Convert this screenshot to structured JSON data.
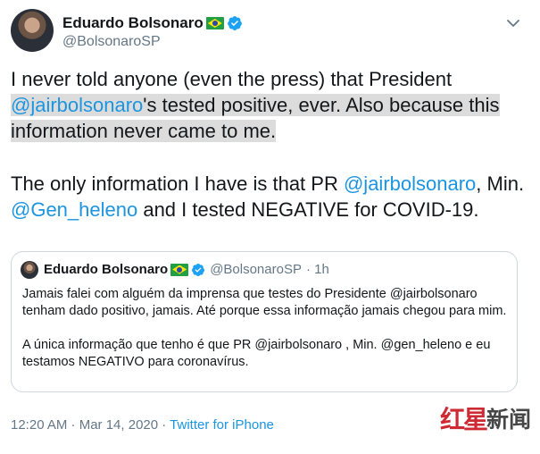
{
  "author": {
    "name": "Eduardo Bolsonaro",
    "handle": "@BolsonaroSP",
    "flag": "brazil-flag-emoji",
    "verified_color": "#1da1f2"
  },
  "tweet": {
    "line1_pre": "I never told anyone (even the press) that President",
    "mention1": "@jairbolsonaro",
    "line2_hl": "'s tested positive, ever. Also because this information never came to me.",
    "p2_pre": "The only information I have is that PR ",
    "mention2": "@jairbolsonaro",
    "p2_mid1": ", Min. ",
    "mention3": "@Gen_heleno",
    "p2_end": " and I tested NEGATIVE for COVID-19."
  },
  "quote": {
    "name": "Eduardo Bolsonaro",
    "handle": "@BolsonaroSP",
    "time": "· 1h",
    "para1": "Jamais falei com alguém da imprensa que testes do Presidente @jairbolsonaro tenham dado positivo, jamais. Até porque essa informação jamais chegou para mim.",
    "para2": "A única informação que tenho é que PR @jairbolsonaro , Min. @gen_heleno e eu testamos NEGATIVO para coronavírus."
  },
  "meta": {
    "timestamp": "12:20 AM · Mar 14, 2020 · ",
    "source": "Twitter for iPhone"
  },
  "watermark": {
    "text1": "红星",
    "text2": "新闻"
  },
  "colors": {
    "link": "#1b95e0",
    "secondary": "#657786",
    "highlight": "#dcdcdc",
    "watermark_red": "#c8141e"
  }
}
